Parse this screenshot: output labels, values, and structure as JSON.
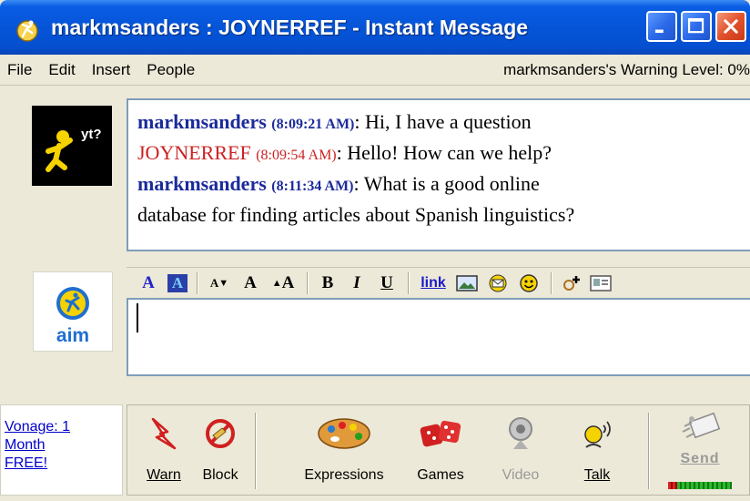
{
  "window": {
    "title": "markmsanders : JOYNERREF - Instant Message",
    "buttons": {
      "minimize_icon": "minimize-icon",
      "maximize_icon": "maximize-icon",
      "close_icon": "close-icon"
    }
  },
  "menu": {
    "items": [
      "File",
      "Edit",
      "Insert",
      "People"
    ],
    "warning": "markmsanders's Warning Level: 0%"
  },
  "buddy_icon": {
    "text": "yt?"
  },
  "aim_logo": {
    "text": "aim"
  },
  "conversation": [
    {
      "sender": "markmsanders",
      "time": "(8:09:21 AM)",
      "text": ": Hi, I have a question",
      "color": "#1c2b9a"
    },
    {
      "sender": "JOYNERREF",
      "time": "(8:09:54 AM)",
      "text": ": Hello!  How can we help?",
      "color": "#cc2222"
    },
    {
      "sender": "markmsanders",
      "time": "(8:11:34 AM)",
      "text": ": What is a good online",
      "color": "#1c2b9a"
    },
    {
      "sender": "",
      "time": "",
      "text": "database for finding articles about Spanish linguistics?",
      "color": "#000000"
    }
  ],
  "format_toolbar": {
    "text_color": "A",
    "bg_color": "A",
    "smaller_font": "A",
    "normal_font": "A",
    "larger_font": "A",
    "bold": "B",
    "italic": "I",
    "underline": "U",
    "link": "link"
  },
  "input": {
    "value": ""
  },
  "ad": {
    "line1": "Vonage: 1",
    "line2": "Month",
    "line3": "FREE!"
  },
  "bottom_toolbar": {
    "warn": "Warn",
    "block": "Block",
    "expressions": "Expressions",
    "games": "Games",
    "video": "Video",
    "talk": "Talk",
    "send": "Send"
  },
  "colors": {
    "title_blue": "#0554d8",
    "sender_blue": "#1c2b9a",
    "sender_red": "#cc2222",
    "link_blue": "#0000cc"
  }
}
